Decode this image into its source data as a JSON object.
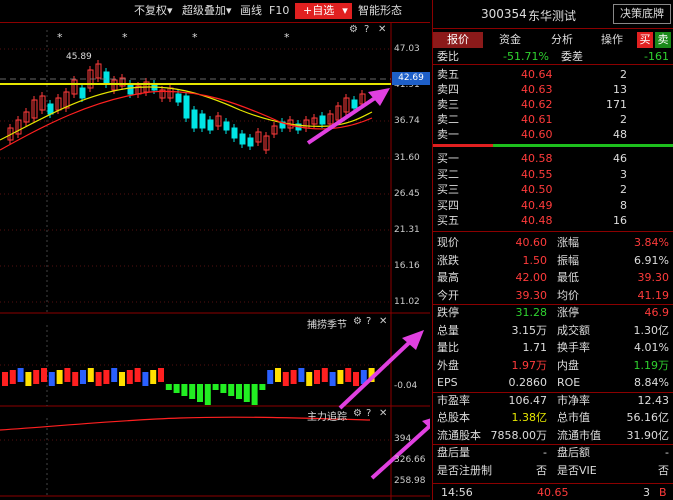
{
  "toolbar": {
    "adjust": "不复权",
    "overlay": "超级叠加",
    "draw": "画线",
    "f10": "F10",
    "add_watchlist": "+自选",
    "smart_pattern": "智能形态"
  },
  "stock": {
    "code": "300354",
    "name": "东华测试",
    "decision_button": "决策底牌"
  },
  "panel_tabs": {
    "quote": "报价",
    "funds": "资金",
    "analysis": "分析",
    "operate": "操作",
    "buy": "买",
    "sell": "卖"
  },
  "committee": {
    "ratio_label": "委比",
    "ratio_value": "-51.71%",
    "diff_label": "委差",
    "diff_value": "-161"
  },
  "asks": [
    {
      "label": "卖五",
      "price": "40.64",
      "vol": "2"
    },
    {
      "label": "卖四",
      "price": "40.63",
      "vol": "13"
    },
    {
      "label": "卖三",
      "price": "40.62",
      "vol": "171"
    },
    {
      "label": "卖二",
      "price": "40.61",
      "vol": "2"
    },
    {
      "label": "卖一",
      "price": "40.60",
      "vol": "48"
    }
  ],
  "bids": [
    {
      "label": "买一",
      "price": "40.58",
      "vol": "46"
    },
    {
      "label": "买二",
      "price": "40.55",
      "vol": "3"
    },
    {
      "label": "买三",
      "price": "40.50",
      "vol": "2"
    },
    {
      "label": "买四",
      "price": "40.49",
      "vol": "8"
    },
    {
      "label": "买五",
      "price": "40.48",
      "vol": "16"
    }
  ],
  "stats": [
    {
      "l1": "现价",
      "v1": "40.60",
      "c1": "red",
      "l2": "涨幅",
      "v2": "3.84%",
      "c2": "red"
    },
    {
      "l1": "涨跌",
      "v1": "1.50",
      "c1": "red",
      "l2": "振幅",
      "v2": "6.91%",
      "c2": "white"
    },
    {
      "l1": "最高",
      "v1": "42.00",
      "c1": "red",
      "l2": "最低",
      "v2": "39.30",
      "c2": "red"
    },
    {
      "l1": "今开",
      "v1": "39.30",
      "c1": "red",
      "l2": "均价",
      "v2": "41.19",
      "c2": "red"
    },
    {
      "l1": "跌停",
      "v1": "31.28",
      "c1": "green",
      "l2": "涨停",
      "v2": "46.9",
      "c2": "red"
    },
    {
      "l1": "总量",
      "v1": "3.15万",
      "c1": "white",
      "l2": "成交额",
      "v2": "1.30亿",
      "c2": "white"
    },
    {
      "l1": "量比",
      "v1": "1.71",
      "c1": "white",
      "l2": "换手率",
      "v2": "4.01%",
      "c2": "white"
    },
    {
      "l1": "外盘",
      "v1": "1.97万",
      "c1": "red",
      "l2": "内盘",
      "v2": "1.19万",
      "c2": "green"
    },
    {
      "l1": "EPS",
      "v1": "0.2860",
      "c1": "white",
      "l2": "ROE",
      "v2": "8.84%",
      "c2": "white"
    },
    {
      "l1": "市盈率",
      "v1": "106.47",
      "c1": "white",
      "l2": "市净率",
      "v2": "12.43",
      "c2": "white"
    },
    {
      "l1": "总股本",
      "v1": "1.38亿",
      "c1": "yellow",
      "l2": "总市值",
      "v2": "56.16亿",
      "c2": "white"
    },
    {
      "l1": "流通股本",
      "v1": "7858.00万",
      "c1": "white",
      "l2": "流通市值",
      "v2": "31.90亿",
      "c2": "white"
    },
    {
      "l1": "盘后量",
      "v1": "-",
      "c1": "white",
      "l2": "盘后额",
      "v2": "-",
      "c2": "white"
    },
    {
      "l1": "是否注册制",
      "v1": "否",
      "c1": "white",
      "l2": "是否VIE",
      "v2": "否",
      "c2": "white"
    }
  ],
  "last_trade": {
    "time": "14:56",
    "price": "40.65",
    "vol": "3",
    "side": "B"
  },
  "chart": {
    "y_labels": [
      "47.03",
      "41.91",
      "36.74",
      "31.60",
      "26.45",
      "21.31",
      "16.16",
      "11.02"
    ],
    "current_price_tag": "42.69",
    "high_label": "45.89",
    "star": "*",
    "ind1_name": "捕捞季节",
    "ind1_value": "-0.04",
    "ind2_name": "主力追踪",
    "ind2_values": [
      "394",
      "326.66",
      "258.98"
    ]
  },
  "colors": {
    "up": "#ff3b3b",
    "down": "#00e5e5",
    "ma_yellow": "#e6e600",
    "ma_red": "#ff2020",
    "arrow": "#e040e0"
  }
}
